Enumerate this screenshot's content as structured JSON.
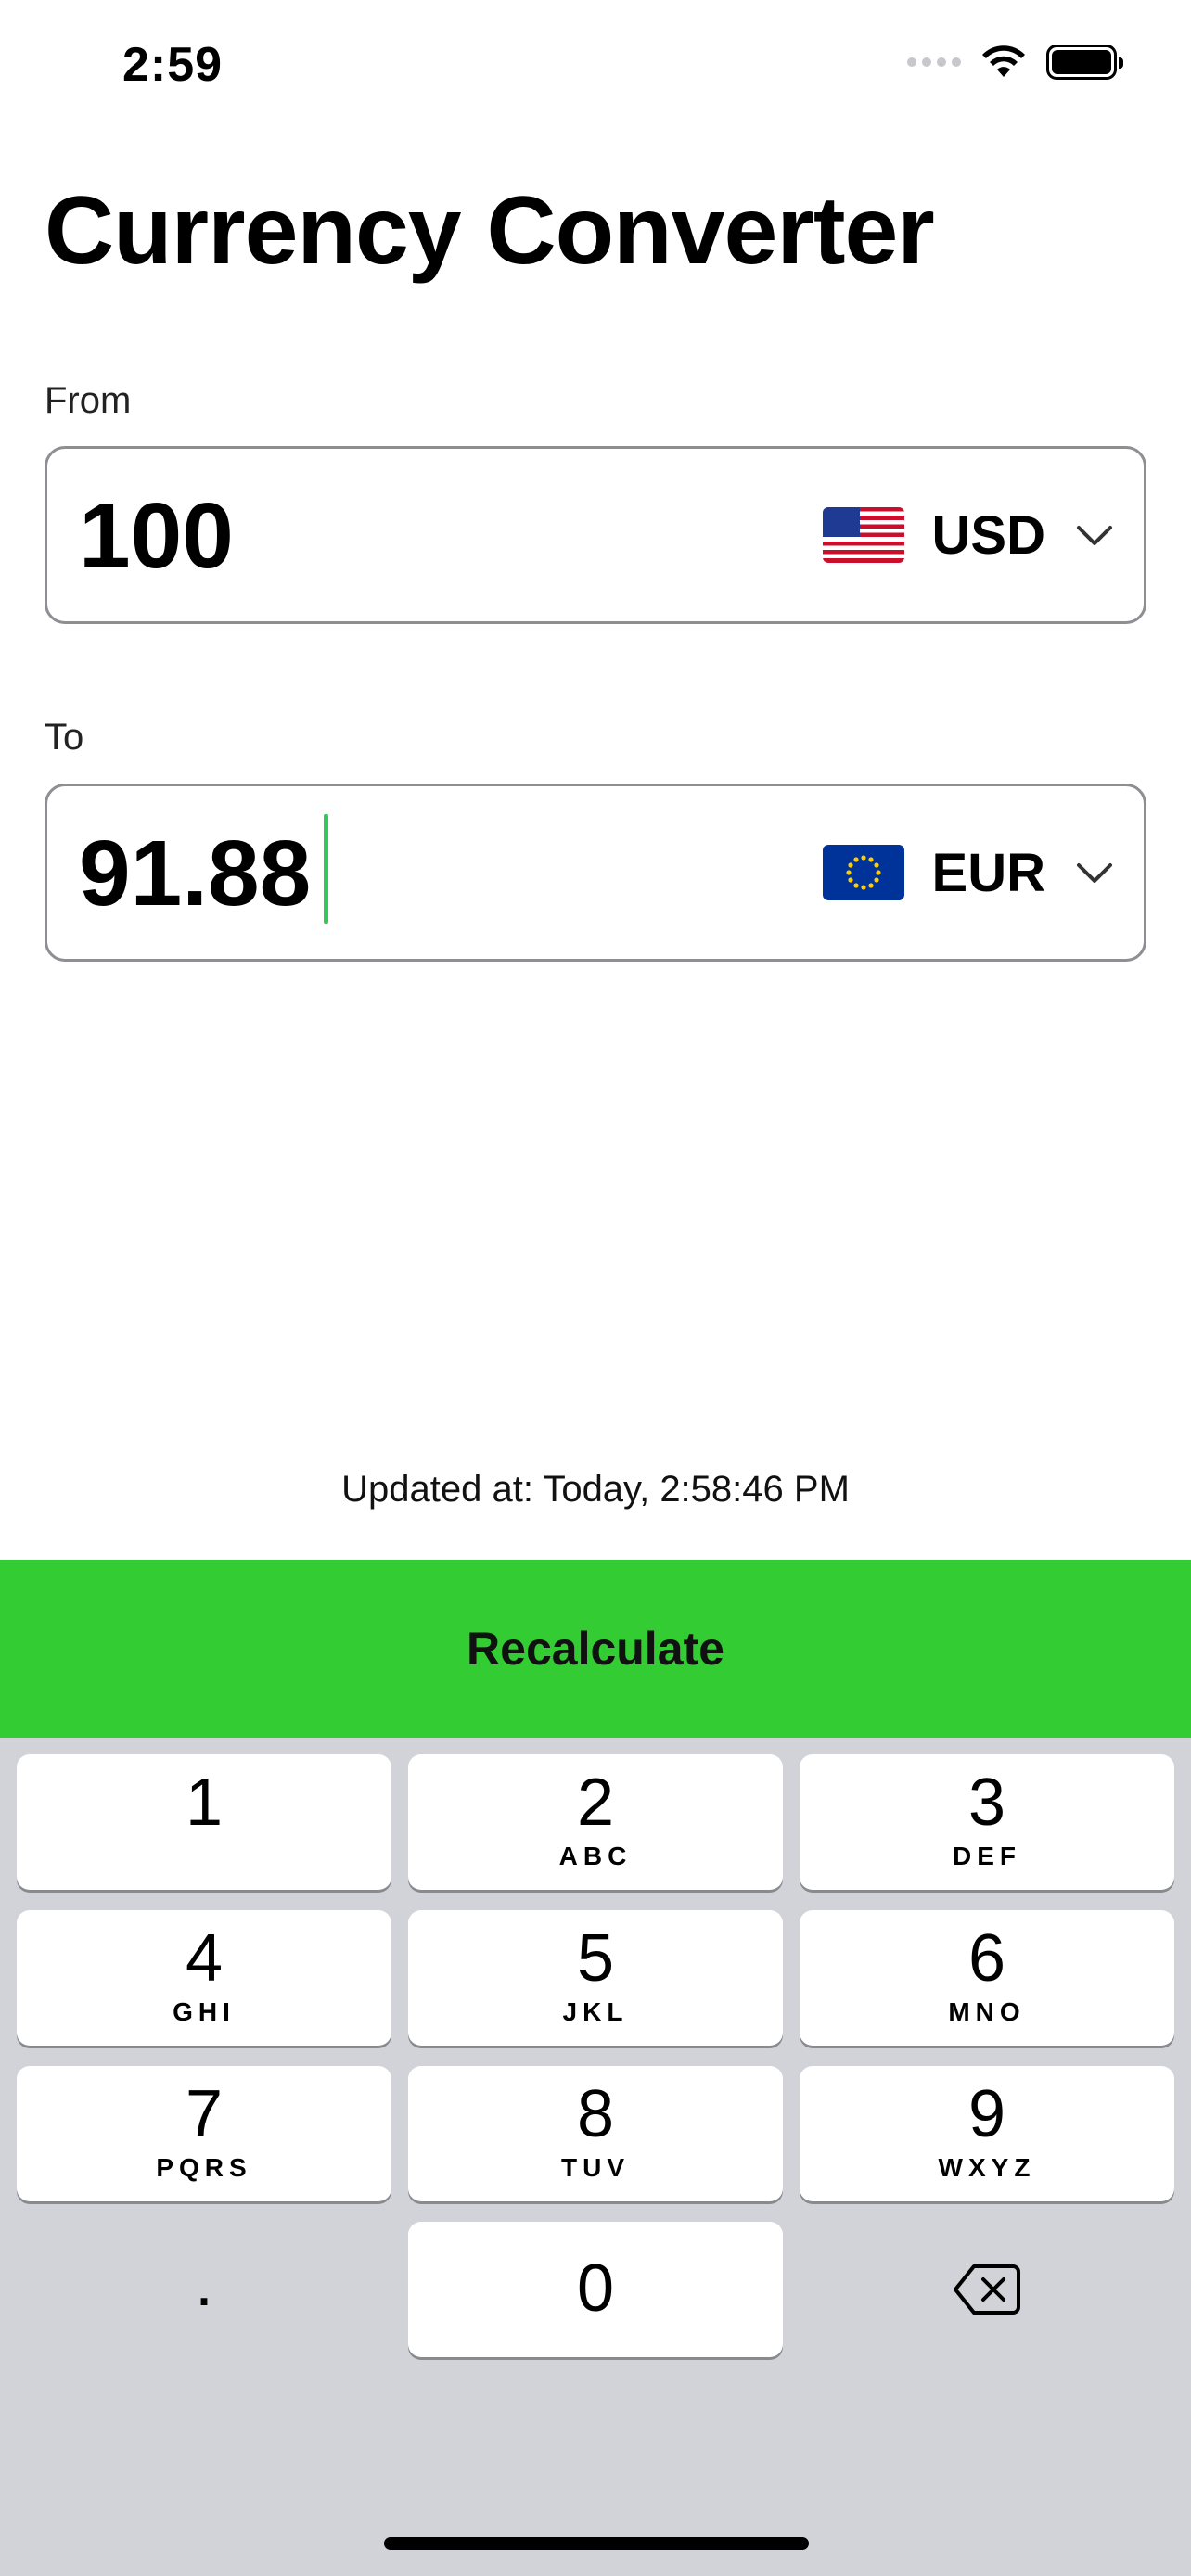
{
  "status_bar": {
    "time": "2:59"
  },
  "header": {
    "title": "Currency Converter"
  },
  "from": {
    "label": "From",
    "amount": "100",
    "currency_code": "USD",
    "flag_icon": "us-flag-icon"
  },
  "to": {
    "label": "To",
    "amount": "91.88",
    "currency_code": "EUR",
    "flag_icon": "eu-flag-icon"
  },
  "updated": {
    "text": "Updated at: Today, 2:58:46 PM"
  },
  "actions": {
    "recalculate_label": "Recalculate"
  },
  "keypad": {
    "keys": [
      {
        "digit": "1",
        "letters": ""
      },
      {
        "digit": "2",
        "letters": "ABC"
      },
      {
        "digit": "3",
        "letters": "DEF"
      },
      {
        "digit": "4",
        "letters": "GHI"
      },
      {
        "digit": "5",
        "letters": "JKL"
      },
      {
        "digit": "6",
        "letters": "MNO"
      },
      {
        "digit": "7",
        "letters": "PQRS"
      },
      {
        "digit": "8",
        "letters": "TUV"
      },
      {
        "digit": "9",
        "letters": "WXYZ"
      },
      {
        "digit": ".",
        "letters": ""
      },
      {
        "digit": "0",
        "letters": ""
      }
    ],
    "backspace_icon": "backspace-icon"
  },
  "colors": {
    "accent": "#33cc33",
    "caret": "#34c759",
    "keypad_background": "#d1d3d9"
  }
}
